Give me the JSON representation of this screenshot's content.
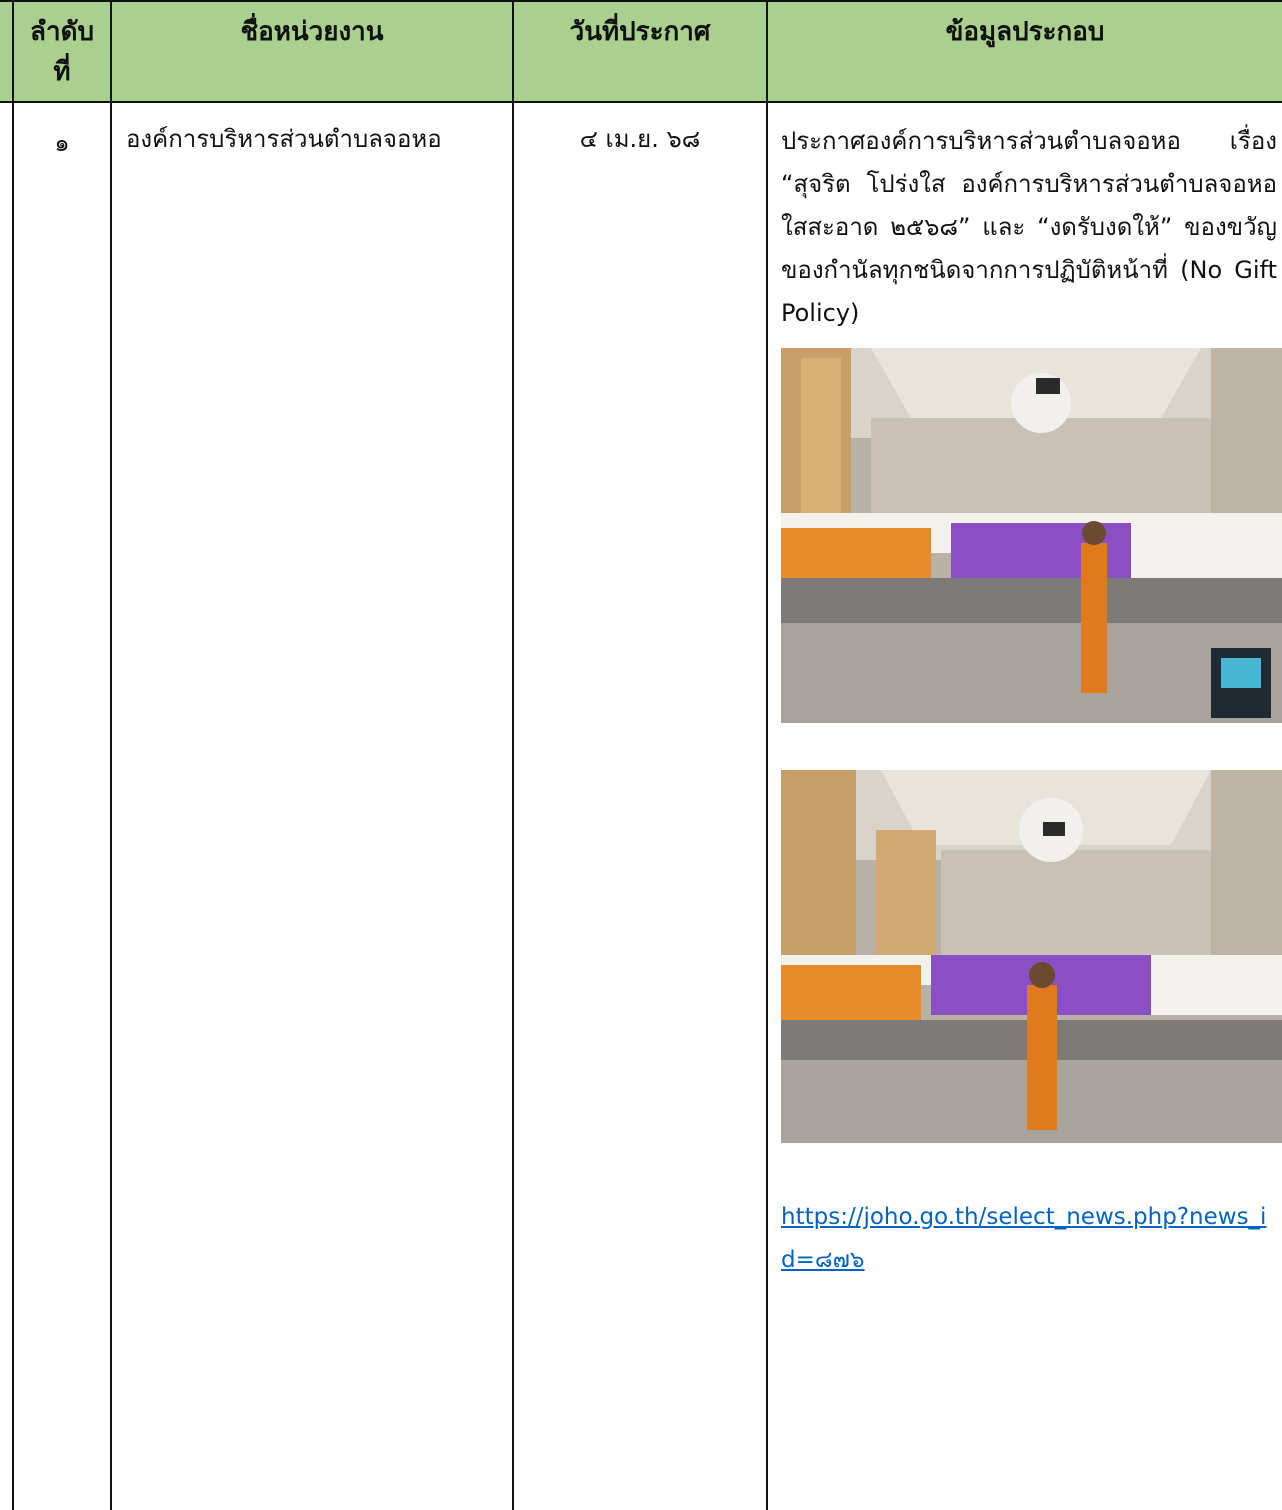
{
  "table": {
    "headers": {
      "no": "ลำดับที่",
      "name": "ชื่อหน่วยงาน",
      "date": "วันที่ประกาศ",
      "info": "ข้อมูลประกอบ"
    },
    "rows": [
      {
        "no": "๑",
        "name": "องค์การบริหารส่วนตำบลจอหอ",
        "date": "๔ เม.ย. ๖๘",
        "detail": "ประกาศองค์การบริหารส่วนตำบลจอหอ เรื่อง “สุจริต โปร่งใส องค์การบริหารส่วนตำบลจอหอ ใสสะอาด ๒๕๖๘” และ “งดรับงดให้” ของขวัญ ของกำนัลทุกชนิดจากการปฏิบัติหน้าที่ (No Gift Policy)",
        "link": "https://joho.go.th/select_news.php?news_id=๘๗๖"
      }
    ]
  },
  "colors": {
    "header_bg": "#a9d08e",
    "link": "#0563c1"
  }
}
